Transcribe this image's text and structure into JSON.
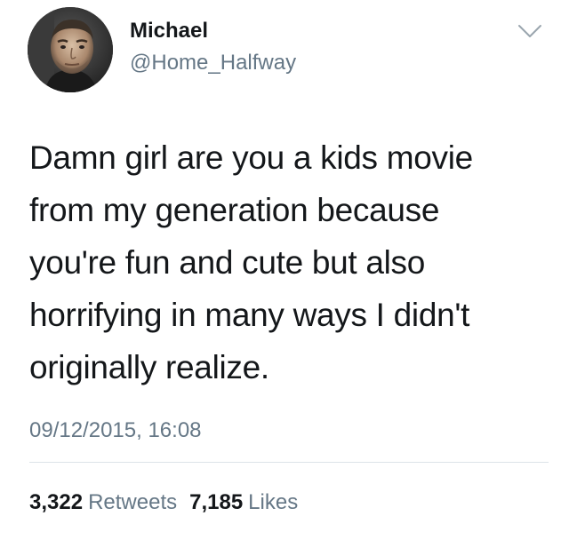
{
  "tweet": {
    "author": {
      "display_name": "Michael",
      "handle": "@Home_Halfway"
    },
    "text_lines": [
      "Damn girl are you a kids movie",
      "from my generation because",
      "you're fun and cute but also",
      "horrifying in many ways I didn't",
      "originally realize."
    ],
    "timestamp": "09/12/2015, 16:08",
    "stats": {
      "retweets_count": "3,322",
      "retweets_label": "Retweets",
      "likes_count": "7,185",
      "likes_label": "Likes"
    }
  },
  "colors": {
    "text_primary": "#14171a",
    "text_secondary": "#657786",
    "divider": "#dde3e8"
  },
  "icons": {
    "caret": "chevron-down-icon"
  }
}
